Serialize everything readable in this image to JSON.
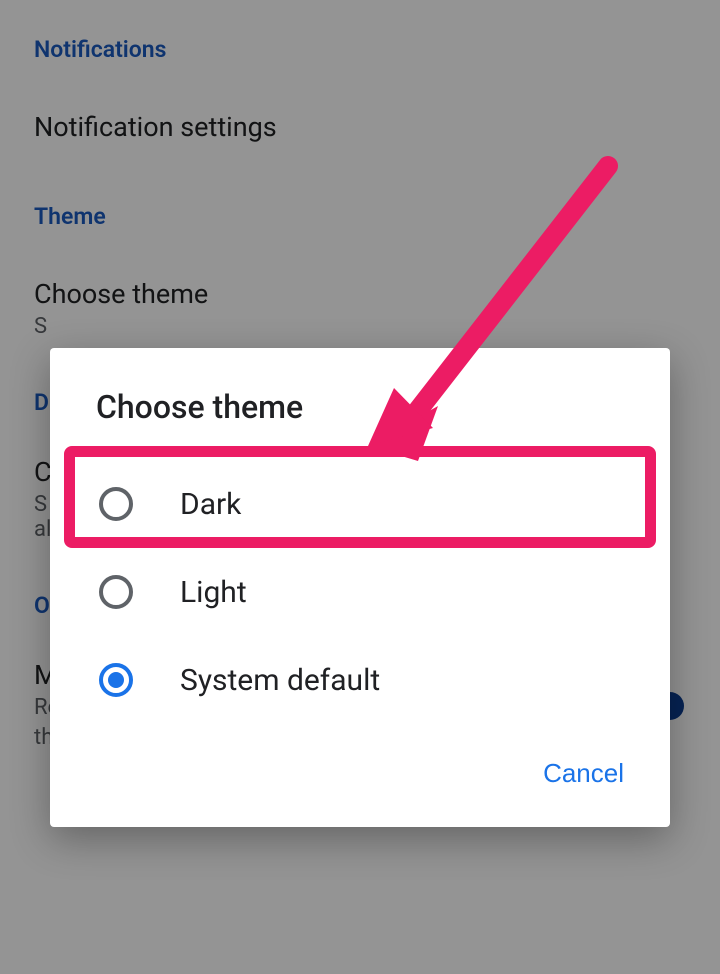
{
  "page": {
    "notifications_header": "Notifications",
    "notification_settings": "Notification settings",
    "theme_header": "Theme",
    "choose_theme_title": "Choose theme",
    "choose_theme_sub": "S",
    "d_header": "D",
    "c_title": "C",
    "s_sub_line1": "S",
    "s_sub_line2": "al",
    "o_header": "O",
    "offline_title": "Make recent files available offline",
    "offline_desc": "Recent files will automatically be made available offline on this device.",
    "offline_toggle_on": true
  },
  "dialog": {
    "title": "Choose theme",
    "options": [
      {
        "label": "Dark",
        "selected": false
      },
      {
        "label": "Light",
        "selected": false
      },
      {
        "label": "System default",
        "selected": true
      }
    ],
    "cancel": "Cancel"
  },
  "annotation": {
    "highlight_color": "#ec1c64"
  }
}
